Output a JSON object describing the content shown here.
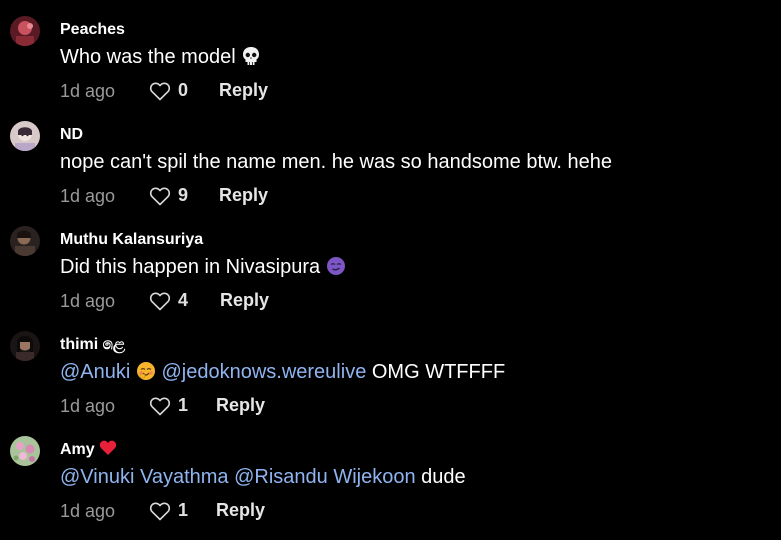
{
  "comments": [
    {
      "username": "Peaches",
      "text": "Who was the model",
      "emoji": "skull-emoji",
      "time": "1d ago",
      "likes": "0",
      "reply": "Reply",
      "avatar": "avatar-peaches"
    },
    {
      "username": "ND",
      "text": "nope can't spil the name men. he was so handsome btw. hehe",
      "time": "1d ago",
      "likes": "9",
      "reply": "Reply",
      "avatar": "avatar-nd"
    },
    {
      "username": "Muthu Kalansuriya",
      "text": "Did this happen in Nivasipura",
      "emoji": "smirk-purple-emoji",
      "time": "1d ago",
      "likes": "4",
      "reply": "Reply",
      "avatar": "avatar-muthu"
    },
    {
      "username": "thimi ෧ළ",
      "mention1": "@Anuki",
      "emoji": "blush-emoji",
      "mention2": "@jedoknows.wereulive",
      "text_tail": "OMG WTFFFF",
      "time": "1d ago",
      "likes": "1",
      "reply": "Reply",
      "avatar": "avatar-thimi"
    },
    {
      "username": "Amy",
      "username_emoji": "red-heart-emoji",
      "mention1": "@Vinuki Vayathma",
      "mention2": "@Risandu Wijekoon",
      "text_tail": "dude",
      "time": "1d ago",
      "likes": "1",
      "reply": "Reply",
      "avatar": "avatar-amy"
    }
  ],
  "colors": {
    "background": "#000000",
    "mention": "#8fb4f0",
    "meta": "#9a9a9a"
  }
}
